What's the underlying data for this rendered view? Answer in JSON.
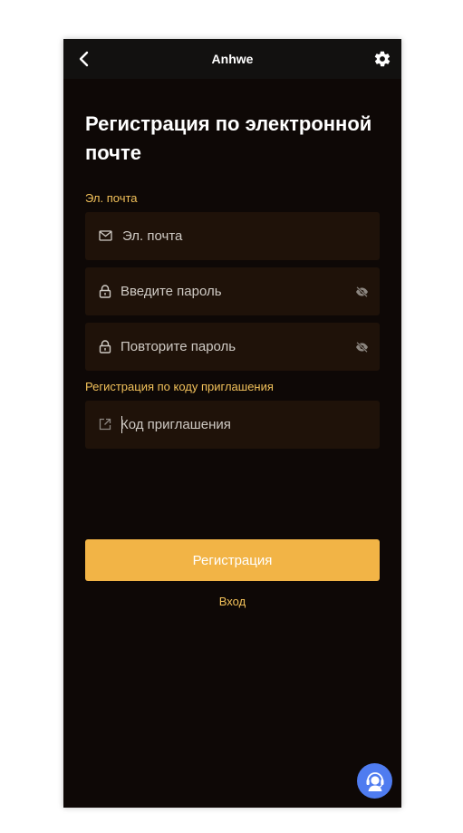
{
  "header": {
    "title": "Anhwe",
    "back_icon": "chevron-left-icon",
    "settings_icon": "gear-icon"
  },
  "page": {
    "title": "Регистрация по электронной почте"
  },
  "form": {
    "email_section_label": "Эл. почта",
    "email": {
      "placeholder": "Эл. почта",
      "value": "",
      "icon": "mail-icon"
    },
    "password": {
      "placeholder": "Введите пароль",
      "value": "",
      "icon": "lock-icon",
      "toggle_icon": "eye-off-icon"
    },
    "password_repeat": {
      "placeholder": "Повторите пароль",
      "value": "",
      "icon": "lock-icon",
      "toggle_icon": "eye-off-icon"
    },
    "invite_section_label": "Регистрация по коду приглашения",
    "invite_code": {
      "placeholder": "Код приглашения",
      "value": "",
      "icon": "external-link-icon"
    },
    "submit_label": "Регистрация",
    "login_link": "Вход"
  },
  "support": {
    "icon": "headset-agent-icon"
  },
  "colors": {
    "background": "#0e0806",
    "field_bg": "#1f1209",
    "accent": "#f2b446",
    "label": "#f2c15a",
    "support": "#4f7cf0"
  }
}
